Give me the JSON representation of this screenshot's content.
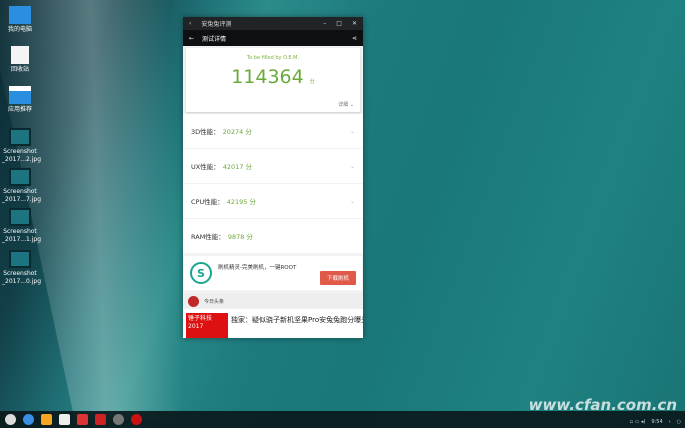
{
  "desktop": {
    "icons": [
      {
        "label": "我的电脑"
      },
      {
        "label": "回收站"
      },
      {
        "label": "应用推荐"
      },
      {
        "label": "Screenshot _2017...2.jpg"
      },
      {
        "label": "Screenshot _2017...7.jpg"
      },
      {
        "label": "Screenshot _2017...1.jpg"
      },
      {
        "label": "Screenshot _2017...0.jpg"
      }
    ]
  },
  "window": {
    "title": "安兔兔评测",
    "header": "测试详情",
    "oem": "To be filled by O.E.M.",
    "score": "114364",
    "score_unit": "分",
    "details": "详细 ⌄",
    "rows": [
      {
        "label": "3D性能：",
        "value": "20274 分"
      },
      {
        "label": "UX性能：",
        "value": "42017 分"
      },
      {
        "label": "CPU性能：",
        "value": "42195 分"
      },
      {
        "label": "RAM性能：",
        "value": "9878 分"
      }
    ],
    "ad": {
      "text": "刷机精灵-完美刷机，一键ROOT",
      "button": "下载刷机"
    },
    "news": {
      "source": "今日头条",
      "headline": "独家：疑似骁子新机坚果Pro安兔兔跑分曝光",
      "thumb": "锤子科技 2017"
    }
  },
  "taskbar": {
    "time": "9:54"
  },
  "watermark": "www.cfan.com.cn"
}
